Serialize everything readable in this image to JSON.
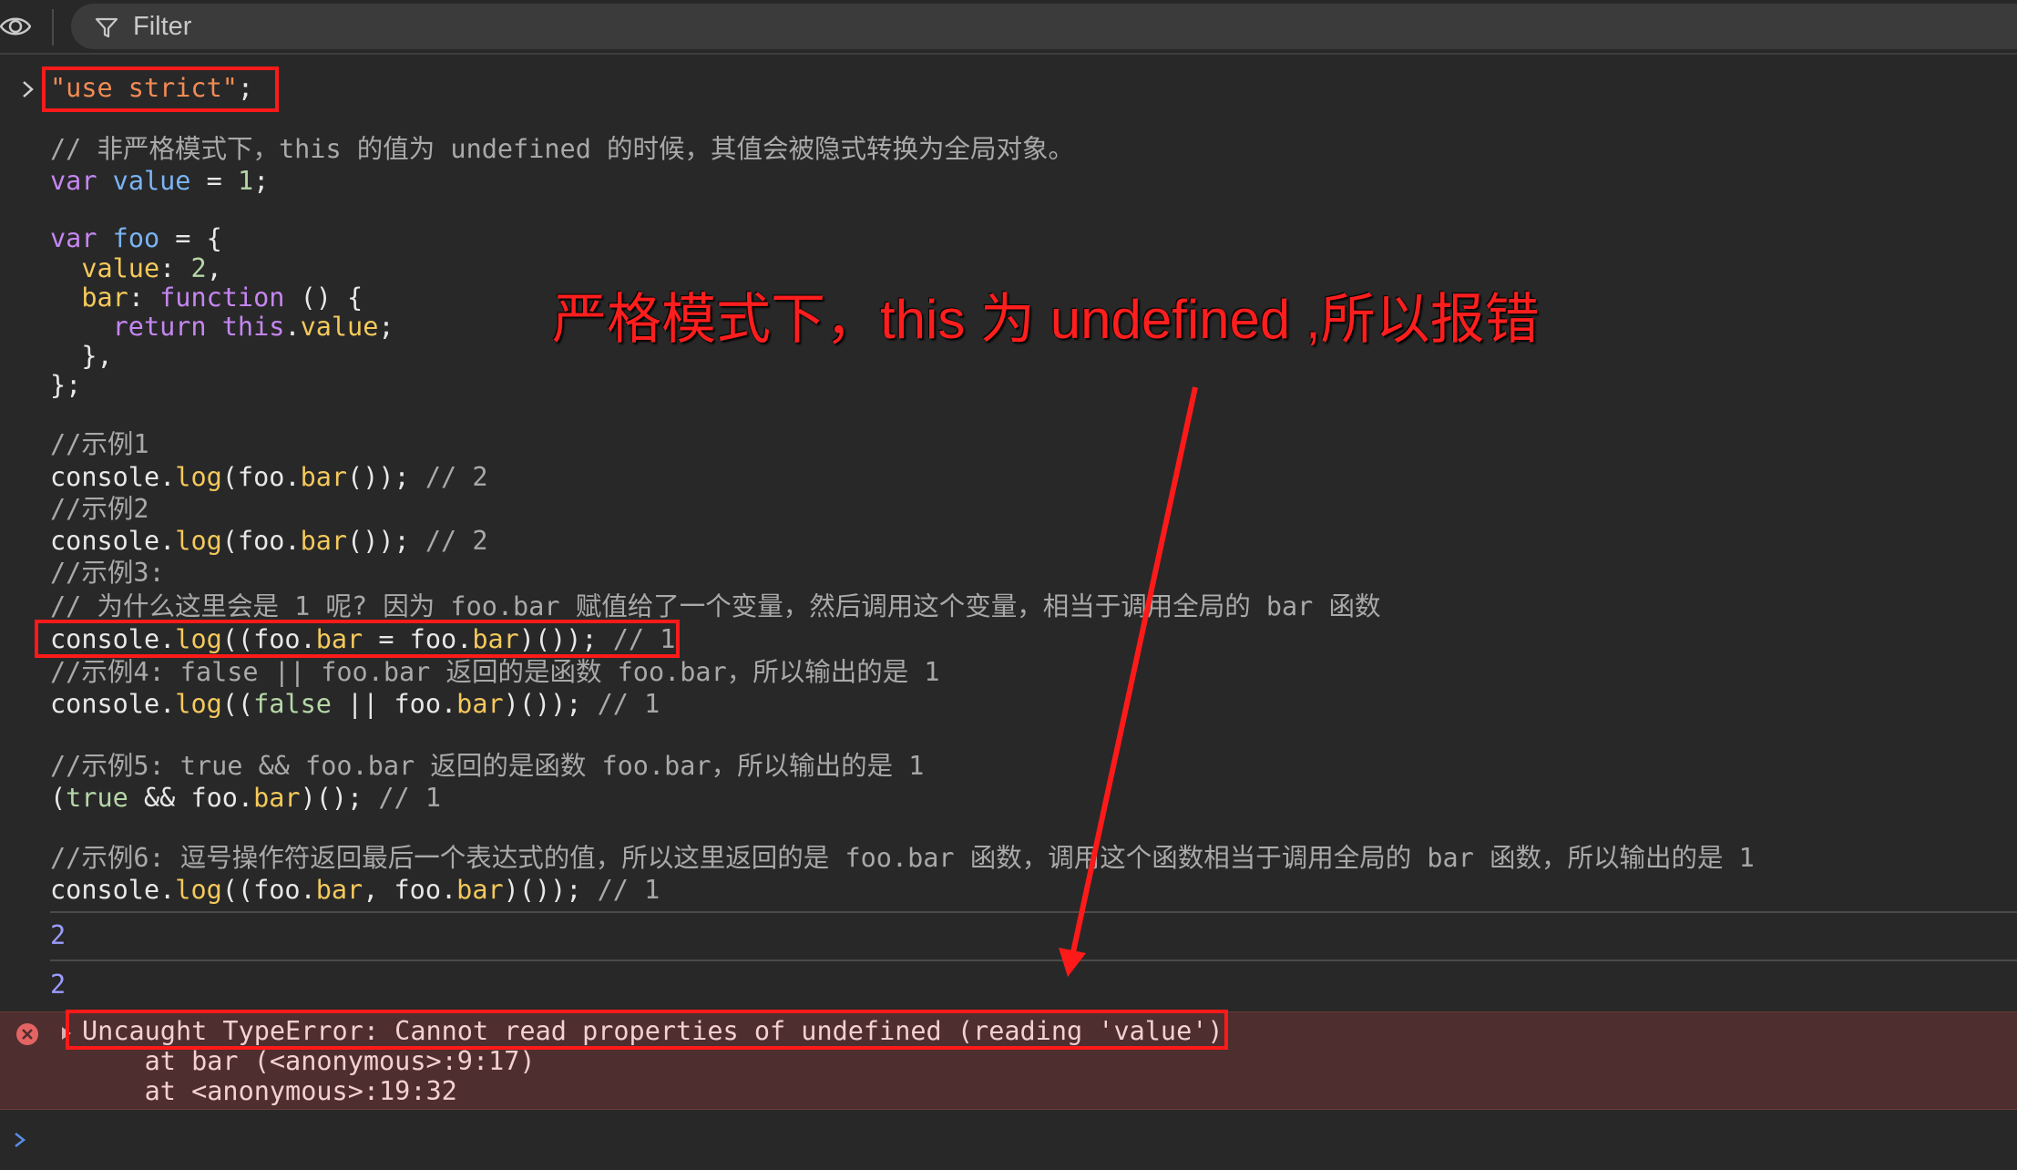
{
  "toolbar": {
    "filter_placeholder": "Filter"
  },
  "input_lines": [
    [
      {
        "t": "\"use strict\"",
        "c": "str"
      },
      {
        "t": ";",
        "c": "plain"
      }
    ],
    [],
    [
      {
        "t": "// 非严格模式下，this 的值为 undefined 的时候，其值会被隐式转换为全局对象。",
        "c": "cmt"
      }
    ],
    [
      {
        "t": "var",
        "c": "kw"
      },
      {
        "t": " ",
        "c": "plain"
      },
      {
        "t": "value",
        "c": "var"
      },
      {
        "t": " = ",
        "c": "plain"
      },
      {
        "t": "1",
        "c": "num"
      },
      {
        "t": ";",
        "c": "plain"
      }
    ],
    [],
    [
      {
        "t": "var",
        "c": "kw"
      },
      {
        "t": " ",
        "c": "plain"
      },
      {
        "t": "foo",
        "c": "var"
      },
      {
        "t": " = {",
        "c": "plain"
      }
    ],
    [
      {
        "t": "  ",
        "c": "plain"
      },
      {
        "t": "value",
        "c": "prop"
      },
      {
        "t": ": ",
        "c": "plain"
      },
      {
        "t": "2",
        "c": "num"
      },
      {
        "t": ",",
        "c": "plain"
      }
    ],
    [
      {
        "t": "  ",
        "c": "plain"
      },
      {
        "t": "bar",
        "c": "prop"
      },
      {
        "t": ": ",
        "c": "plain"
      },
      {
        "t": "function",
        "c": "kw"
      },
      {
        "t": " () {",
        "c": "plain"
      }
    ],
    [
      {
        "t": "    ",
        "c": "plain"
      },
      {
        "t": "return",
        "c": "kw"
      },
      {
        "t": " ",
        "c": "plain"
      },
      {
        "t": "this",
        "c": "kw"
      },
      {
        "t": ".",
        "c": "plain"
      },
      {
        "t": "value",
        "c": "prop"
      },
      {
        "t": ";",
        "c": "plain"
      }
    ],
    [
      {
        "t": "  },",
        "c": "plain"
      }
    ],
    [
      {
        "t": "};",
        "c": "plain"
      }
    ],
    [],
    [
      {
        "t": "//示例1",
        "c": "cmt"
      }
    ],
    [
      {
        "t": "console.",
        "c": "plain"
      },
      {
        "t": "log",
        "c": "prop"
      },
      {
        "t": "(foo.",
        "c": "plain"
      },
      {
        "t": "bar",
        "c": "prop"
      },
      {
        "t": "()); ",
        "c": "plain"
      },
      {
        "t": "// 2",
        "c": "cmt"
      }
    ],
    [
      {
        "t": "//示例2",
        "c": "cmt"
      }
    ],
    [
      {
        "t": "console.",
        "c": "plain"
      },
      {
        "t": "log",
        "c": "prop"
      },
      {
        "t": "(foo.",
        "c": "plain"
      },
      {
        "t": "bar",
        "c": "prop"
      },
      {
        "t": "()); ",
        "c": "plain"
      },
      {
        "t": "// 2",
        "c": "cmt"
      }
    ],
    [
      {
        "t": "//示例3:",
        "c": "cmt"
      }
    ],
    [
      {
        "t": "// 为什么这里会是 1 呢? 因为 foo.bar 赋值给了一个变量，然后调用这个变量，相当于调用全局的 bar 函数",
        "c": "cmt"
      }
    ],
    [
      {
        "t": "console.",
        "c": "plain"
      },
      {
        "t": "log",
        "c": "prop"
      },
      {
        "t": "((foo.",
        "c": "plain"
      },
      {
        "t": "bar",
        "c": "prop"
      },
      {
        "t": " = foo.",
        "c": "plain"
      },
      {
        "t": "bar",
        "c": "prop"
      },
      {
        "t": ")()); ",
        "c": "plain"
      },
      {
        "t": "// 1",
        "c": "cmt"
      }
    ],
    [
      {
        "t": "//示例4: false || foo.bar 返回的是函数 foo.bar，所以输出的是 1",
        "c": "cmt"
      }
    ],
    [
      {
        "t": "console.",
        "c": "plain"
      },
      {
        "t": "log",
        "c": "prop"
      },
      {
        "t": "((",
        "c": "plain"
      },
      {
        "t": "false",
        "c": "num"
      },
      {
        "t": " || foo.",
        "c": "plain"
      },
      {
        "t": "bar",
        "c": "prop"
      },
      {
        "t": ")()); ",
        "c": "plain"
      },
      {
        "t": "// 1",
        "c": "cmt"
      }
    ],
    [],
    [
      {
        "t": "//示例5: true && foo.bar 返回的是函数 foo.bar，所以输出的是 1",
        "c": "cmt"
      }
    ],
    [
      {
        "t": "(",
        "c": "plain"
      },
      {
        "t": "true",
        "c": "num"
      },
      {
        "t": " && foo.",
        "c": "plain"
      },
      {
        "t": "bar",
        "c": "prop"
      },
      {
        "t": ")(); ",
        "c": "plain"
      },
      {
        "t": "// 1",
        "c": "cmt"
      }
    ],
    [],
    [
      {
        "t": "//示例6: 逗号操作符返回最后一个表达式的值，所以这里返回的是 foo.bar 函数，调用这个函数相当于调用全局的 bar 函数，所以输出的是 1",
        "c": "cmt"
      }
    ],
    [
      {
        "t": "console.",
        "c": "plain"
      },
      {
        "t": "log",
        "c": "prop"
      },
      {
        "t": "((foo.",
        "c": "plain"
      },
      {
        "t": "bar",
        "c": "prop"
      },
      {
        "t": ", foo.",
        "c": "plain"
      },
      {
        "t": "bar",
        "c": "prop"
      },
      {
        "t": ")()); ",
        "c": "plain"
      },
      {
        "t": "// 1",
        "c": "cmt"
      }
    ]
  ],
  "outputs": {
    "first": "2",
    "second": "2"
  },
  "error": {
    "message": "Uncaught TypeError: Cannot read properties of undefined (reading 'value')",
    "stack_1": "    at bar (<anonymous>:9:17)",
    "stack_2": "    at <anonymous>:19:32"
  },
  "annotation": {
    "text": "严格模式下，this 为 undefined ,所以报错",
    "color": "#ff1e1e"
  },
  "colors": {
    "keyword": "#c586f0",
    "variable": "#7ab4f4",
    "property": "#f5c95b",
    "string": "#f28b54",
    "number": "#b6d7a8",
    "comment": "#a9a9a9",
    "error_bg": "#4e2e2e"
  }
}
